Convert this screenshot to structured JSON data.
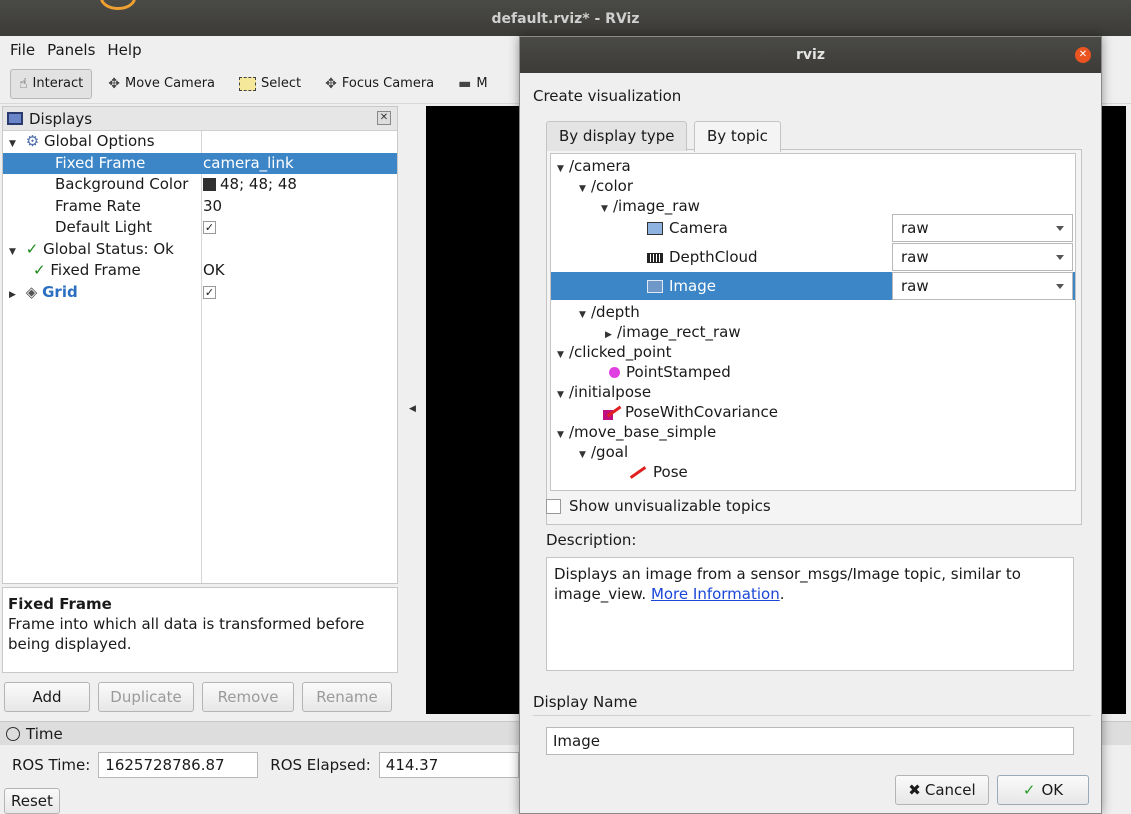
{
  "window": {
    "title": "default.rviz* - RViz"
  },
  "menu": {
    "file": "File",
    "panels": "Panels",
    "help": "Help"
  },
  "toolbar": {
    "interact": "Interact",
    "move_camera": "Move Camera",
    "select": "Select",
    "focus_camera": "Focus Camera",
    "measure_partial": "M"
  },
  "displays": {
    "title": "Displays",
    "rows": {
      "global_options": "Global Options",
      "fixed_frame_label": "Fixed Frame",
      "fixed_frame_value": "camera_link",
      "bg_color_label": "Background Color",
      "bg_color_value": "48; 48; 48",
      "frame_rate_label": "Frame Rate",
      "frame_rate_value": "30",
      "default_light_label": "Default Light",
      "global_status": "Global Status: Ok",
      "status_fixed_frame": "Fixed Frame",
      "status_fixed_frame_value": "OK",
      "grid": "Grid"
    },
    "description_title": "Fixed Frame",
    "description_text": "Frame into which all data is transformed before being displayed.",
    "buttons": {
      "add": "Add",
      "duplicate": "Duplicate",
      "remove": "Remove",
      "rename": "Rename"
    }
  },
  "time": {
    "title": "Time",
    "ros_time_label": "ROS Time:",
    "ros_time_value": "1625728786.87",
    "ros_elapsed_label": "ROS Elapsed:",
    "ros_elapsed_value": "414.37",
    "reset": "Reset"
  },
  "dialog": {
    "title": "rviz",
    "create_label": "Create visualization",
    "tabs": {
      "by_display_type": "By display type",
      "by_topic": "By topic"
    },
    "tree": {
      "camera": "/camera",
      "color": "/color",
      "image_raw": "/image_raw",
      "camera_item": "Camera",
      "depthcloud_item": "DepthCloud",
      "image_item": "Image",
      "combo_value": "raw",
      "depth": "/depth",
      "image_rect_raw": "/image_rect_raw",
      "clicked_point": "/clicked_point",
      "point_stamped": "PointStamped",
      "initialpose": "/initialpose",
      "pose_with_cov": "PoseWithCovariance",
      "move_base_simple": "/move_base_simple",
      "goal": "/goal",
      "pose": "Pose"
    },
    "show_unvisualizable": "Show unvisualizable topics",
    "description_label": "Description:",
    "description_text": "Displays an image from a sensor_msgs/Image topic, similar to image_view.",
    "more_info": "More Information",
    "display_name_label": "Display Name",
    "display_name_value": "Image",
    "cancel": "Cancel",
    "ok": "OK"
  },
  "colors": {
    "selection": "#3c86c7",
    "close_button": "#e95420",
    "grid_label": "#2b6fc0"
  }
}
